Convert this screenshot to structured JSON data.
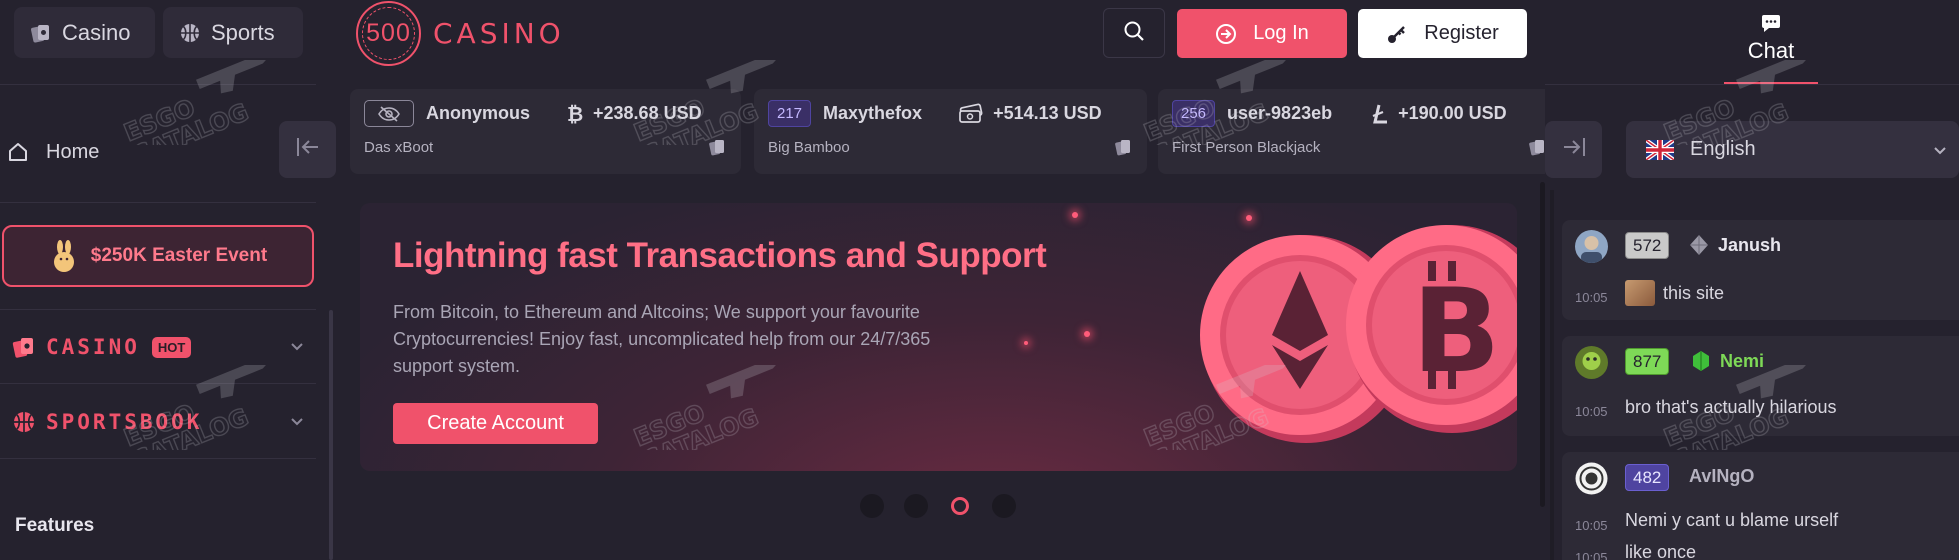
{
  "sidebar": {
    "tabs": [
      {
        "label": "Casino"
      },
      {
        "label": "Sports"
      }
    ],
    "home_label": "Home",
    "event_label": "$250K Easter Event",
    "casino_label": "CASINO",
    "hot_badge": "HOT",
    "sportsbook_label": "SPORTSBOOK",
    "features_label": "Features"
  },
  "header": {
    "logo_number": "500",
    "logo_text": "CASINO",
    "login_label": "Log In",
    "register_label": "Register"
  },
  "feed": [
    {
      "user": "Anonymous",
      "amount": "+238.68 USD",
      "game": "Das xBoot",
      "coin": "bitcoin-icon"
    },
    {
      "level": "217",
      "user": "Maxythefox",
      "amount": "+514.13 USD",
      "game": "Big Bamboo",
      "coin": "cash-stack-icon"
    },
    {
      "level": "256",
      "user": "user-9823eb",
      "amount": "+190.00 USD",
      "game": "First Person Blackjack",
      "coin": "litecoin-icon"
    }
  ],
  "banner": {
    "title": "Lightning fast Transactions and Support",
    "text": "From Bitcoin, to Ethereum and Altcoins; We support your favourite Cryptocurrencies! Enjoy fast, uncomplicated help from our 24/7/365 support system.",
    "button_label": "Create Account",
    "slides": 4,
    "active_slide": 3
  },
  "right_panel": {
    "chat_tab_label": "Chat",
    "language": "English"
  },
  "chat": [
    {
      "level": "572",
      "name": "Janush",
      "time": "10:05",
      "text": "this site",
      "badge_color": "#c9c9c9",
      "name_color": "#e8e6ee"
    },
    {
      "level": "877",
      "name": "Nemi",
      "time": "10:05",
      "text": "bro that's actually hilarious",
      "badge_color": "#7ed957",
      "name_color": "#7ed957"
    },
    {
      "level": "482",
      "name": "AvINgO",
      "time": "10:05",
      "text": "Nemi y cant u blame urself",
      "time2": "10:05",
      "text2": "like once",
      "badge_color": "#4f44a0",
      "name_color": "#b5b2c0"
    }
  ],
  "colors": {
    "accent": "#f0526b",
    "background": "#25222e",
    "panel": "#2d2a36"
  }
}
